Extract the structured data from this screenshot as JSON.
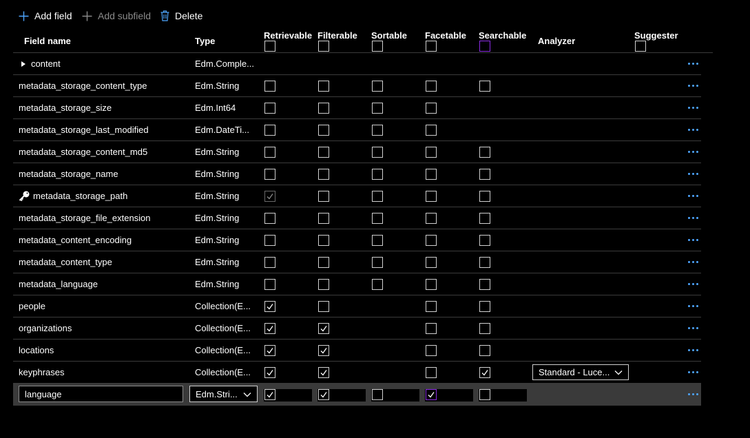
{
  "toolbar": {
    "add_field": "Add field",
    "add_subfield": "Add subfield",
    "delete": "Delete"
  },
  "columns": {
    "field_name": "Field name",
    "type": "Type",
    "retrievable": "Retrievable",
    "filterable": "Filterable",
    "sortable": "Sortable",
    "facetable": "Facetable",
    "searchable": "Searchable",
    "analyzer": "Analyzer",
    "suggester": "Suggester"
  },
  "rows": [
    {
      "name": "content",
      "type": "Edm.Comple...",
      "expander": true
    },
    {
      "name": "metadata_storage_content_type",
      "type": "Edm.String"
    },
    {
      "name": "metadata_storage_size",
      "type": "Edm.Int64"
    },
    {
      "name": "metadata_storage_last_modified",
      "type": "Edm.DateTi..."
    },
    {
      "name": "metadata_storage_content_md5",
      "type": "Edm.String"
    },
    {
      "name": "metadata_storage_name",
      "type": "Edm.String"
    },
    {
      "name": "metadata_storage_path",
      "type": "Edm.String",
      "key": true
    },
    {
      "name": "metadata_storage_file_extension",
      "type": "Edm.String"
    },
    {
      "name": "metadata_content_encoding",
      "type": "Edm.String"
    },
    {
      "name": "metadata_content_type",
      "type": "Edm.String"
    },
    {
      "name": "metadata_language",
      "type": "Edm.String"
    },
    {
      "name": "people",
      "type": "Collection(E..."
    },
    {
      "name": "organizations",
      "type": "Collection(E..."
    },
    {
      "name": "locations",
      "type": "Collection(E..."
    },
    {
      "name": "keyphrases",
      "type": "Collection(E...",
      "analyzer": "Standard - Luce..."
    }
  ],
  "edit_row": {
    "name_value": "language",
    "type_value": "Edm.Stri..."
  },
  "colors": {
    "accent": "#4ea6ff",
    "selected_row": "#3a3a3a",
    "focus_purple": "#8a2be2"
  }
}
